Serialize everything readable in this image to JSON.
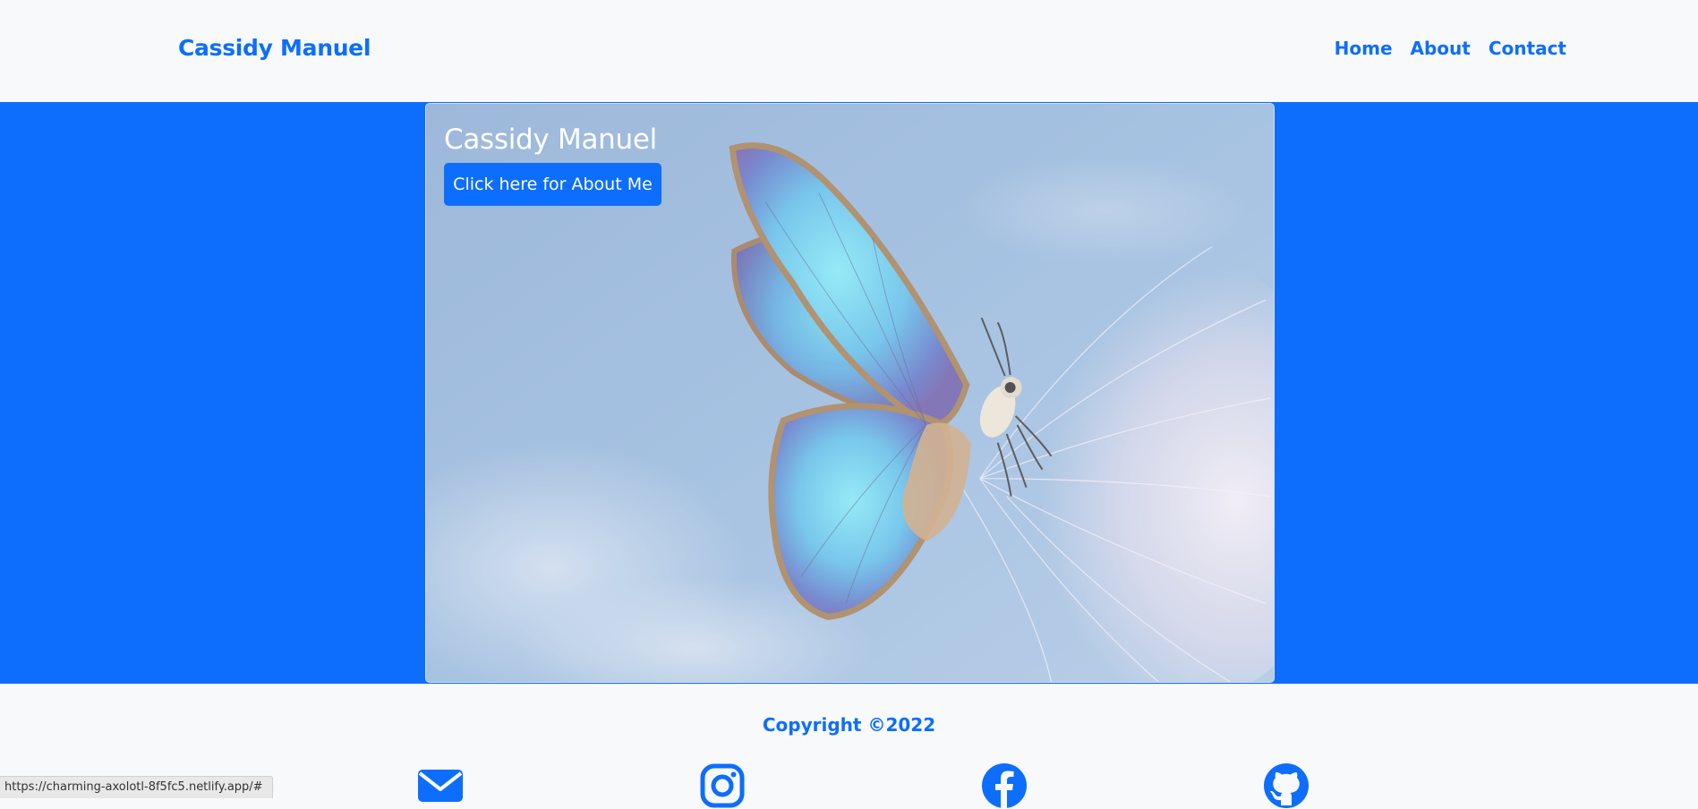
{
  "navbar": {
    "brand": "Cassidy Manuel",
    "links": [
      {
        "label": "Home"
      },
      {
        "label": "About"
      },
      {
        "label": "Contact"
      }
    ]
  },
  "hero": {
    "card_title": "Cassidy Manuel",
    "button_label": "Click here for About Me",
    "image_subject": "butterfly-on-dandelion"
  },
  "footer": {
    "copyright": "Copyright ©2022",
    "social_icons": [
      "envelope-icon",
      "instagram-icon",
      "facebook-icon",
      "github-icon"
    ]
  },
  "status_bar": {
    "url": "https://charming-axolotl-8f5fc5.netlify.app/#"
  },
  "colors": {
    "primary": "#0d6efd",
    "background": "#f8f9fa",
    "white": "#ffffff"
  }
}
